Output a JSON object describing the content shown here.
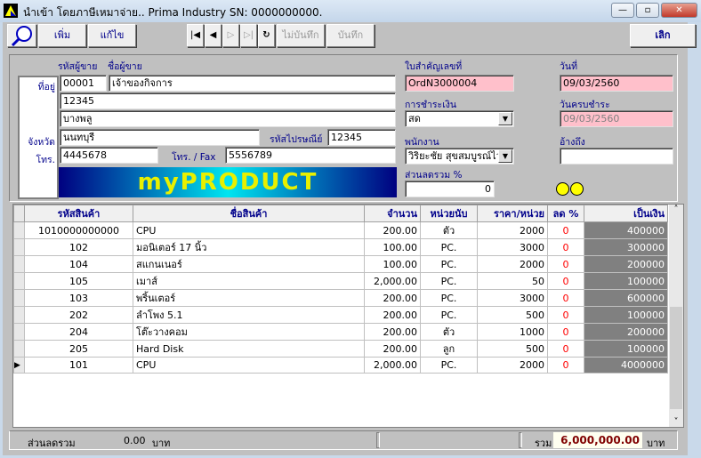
{
  "window": {
    "title": "นำเข้า โดยภาษีเหมาจ่าย..  Prima Industry SN: 0000000000.",
    "minimize": "—",
    "maximize": "▫",
    "close": "✕"
  },
  "toolbar": {
    "add": "เพิ่ม",
    "edit": "แก้ไข",
    "first": "|◀",
    "prev": "◀",
    "next": "▷",
    "last": "▷|",
    "refresh": "↻",
    "cancel": "ไม่บันทึก",
    "save": "บันทึก",
    "exit": "เลิก"
  },
  "form": {
    "seller_code_label": "รหัสผู้ขาย",
    "seller_name_label": "ชื่อผู้ขาย",
    "address_label": "ที่อยู่",
    "province_label": "จังหวัด",
    "phone_label": "โทร.",
    "seller_code": "00001",
    "seller_name": "เจ้าของกิจการ",
    "address1": "12345",
    "address2": "บางพลู",
    "province": "นนทบุรี",
    "postal_label": "รหัสไปรษณีย์",
    "postal": "12345",
    "phone": "4445678",
    "fax_label": "โทร. / Fax",
    "fax": "5556789",
    "banner": "myPRODUCT",
    "doc_no_label": "ใบสำคัญเลขที่",
    "doc_no": "OrdN3000004",
    "date_label": "วันที่",
    "date": "09/03/2560",
    "payment_label": "การชำระเงิน",
    "payment": "สด",
    "due_label": "วันครบชำระ",
    "due": "09/03/2560",
    "employee_label": "พนักงาน",
    "employee": "วิริยะชัย  สุขสมบูรณ์ไว",
    "ref_label": "อ้างถึง",
    "ref": "",
    "discount_label": "ส่วนลดรวม %",
    "discount": "0"
  },
  "grid": {
    "columns": [
      "รหัสสินค้า",
      "ชื่อสินค้า",
      "จำนวน",
      "หน่วยนับ",
      "ราคา/หน่วย",
      "ลด %",
      "เป็นเงิน"
    ],
    "rows": [
      [
        "1010000000000",
        "CPU",
        "200.00",
        "ตัว",
        "2000",
        "0",
        "400000"
      ],
      [
        "102",
        "มอนิเตอร์ 17 นิ้ว",
        "100.00",
        "PC.",
        "3000",
        "0",
        "300000"
      ],
      [
        "104",
        "สแกนเนอร์",
        "100.00",
        "PC.",
        "2000",
        "0",
        "200000"
      ],
      [
        "105",
        "เมาส์",
        "2,000.00",
        "PC.",
        "50",
        "0",
        "100000"
      ],
      [
        "103",
        "พริ้นเตอร์",
        "200.00",
        "PC.",
        "3000",
        "0",
        "600000"
      ],
      [
        "202",
        "ลำโพง 5.1",
        "200.00",
        "PC.",
        "500",
        "0",
        "100000"
      ],
      [
        "204",
        "โต๊ะวางคอม",
        "200.00",
        "ตัว",
        "1000",
        "0",
        "200000"
      ],
      [
        "205",
        "Hard Disk",
        "200.00",
        "ลูก",
        "500",
        "0",
        "100000"
      ],
      [
        "101",
        "CPU",
        "2,000.00",
        "PC.",
        "2000",
        "0",
        "4000000"
      ]
    ],
    "current_row": 8
  },
  "status": {
    "discount_label": "ส่วนลดรวม",
    "discount_value": "0.00",
    "currency": "บาท",
    "total_label": "รวม",
    "total": "6,000,000.00",
    "total_currency": "บาท"
  },
  "colors": {
    "pink_field": "#ffc0cb",
    "amount_bg": "#808080",
    "discount_text": "#ff0000",
    "label_blue": "#00008b",
    "total_text": "#800000"
  }
}
